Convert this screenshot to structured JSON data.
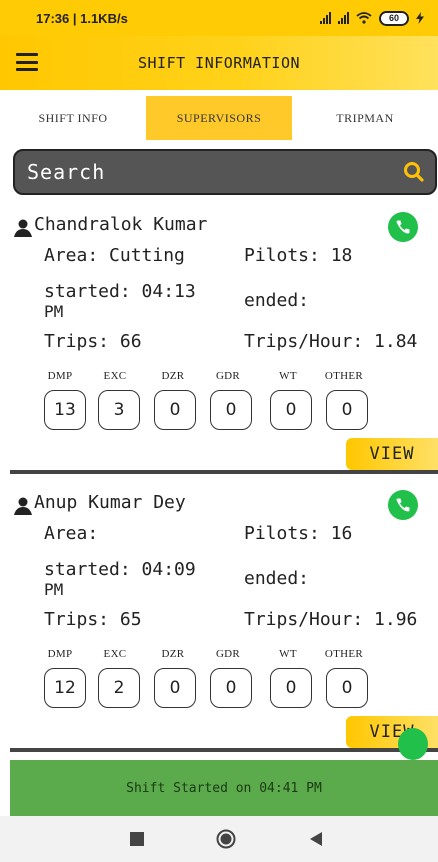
{
  "status_bar": {
    "time_speed": "17:36 | 1.1KB/s",
    "battery": "60"
  },
  "app_bar": {
    "title": "SHIFT INFORMATION"
  },
  "tabs": [
    {
      "label": "SHIFT INFO"
    },
    {
      "label": "SUPERVISORS"
    },
    {
      "label": "TRIPMAN"
    }
  ],
  "search": {
    "placeholder": "Search"
  },
  "supervisors": [
    {
      "name": "Chandralok Kumar",
      "area": "Area: Cutting",
      "pilots": "Pilots: 18",
      "started_line1": "started: 04:13",
      "started_line2": "PM",
      "ended": "ended:",
      "trips": "Trips: 66",
      "trips_hour": "Trips/Hour: 1.84",
      "categories": [
        "DMP",
        "EXC",
        "DZR",
        "GDR",
        "WT",
        "OTHER"
      ],
      "counts": [
        "13",
        "3",
        "0",
        "0",
        "0",
        "0"
      ],
      "view_label": "VIEW"
    },
    {
      "name": "Anup Kumar Dey",
      "area": "Area:",
      "pilots": "Pilots: 16",
      "started_line1": "started: 04:09",
      "started_line2": "PM",
      "ended": "ended:",
      "trips": "Trips: 65",
      "trips_hour": "Trips/Hour: 1.96",
      "categories": [
        "DMP",
        "EXC",
        "DZR",
        "GDR",
        "WT",
        "OTHER"
      ],
      "counts": [
        "12",
        "2",
        "0",
        "0",
        "0",
        "0"
      ],
      "view_label": "VIEW"
    }
  ],
  "banner": {
    "text": "Shift Started on 04:41 PM"
  },
  "colors": {
    "accent": "#FFCB05",
    "call": "#21C04A",
    "banner": "#5BAA4B"
  }
}
